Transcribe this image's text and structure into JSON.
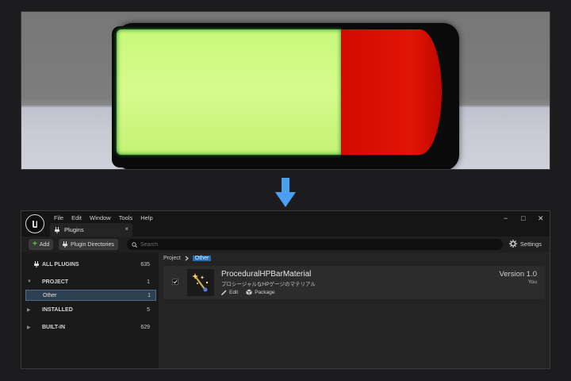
{
  "colors": {
    "accent": "#1f70b8",
    "hp_fill": "#d2fa86",
    "hp_empty": "#e11405",
    "arrow": "#4a9ff0"
  },
  "hp_bar": {
    "fill_fraction": 0.69
  },
  "window": {
    "menu": [
      "File",
      "Edit",
      "Window",
      "Tools",
      "Help"
    ],
    "tab_label": "Plugins",
    "tab_icon": "plug-icon",
    "controls": {
      "minimize": "−",
      "maximize": "□",
      "close": "✕"
    }
  },
  "toolbar": {
    "add_label": "Add",
    "plugin_dirs_label": "Plugin Directories",
    "search_placeholder": "Search",
    "settings_label": "Settings"
  },
  "sidebar": {
    "items": [
      {
        "label": "ALL PLUGINS",
        "count": "635"
      },
      {
        "label": "PROJECT",
        "count": "1"
      },
      {
        "label": "Other",
        "count": "1"
      },
      {
        "label": "INSTALLED",
        "count": "5"
      },
      {
        "label": "BUILT-IN",
        "count": "629"
      }
    ]
  },
  "main": {
    "breadcrumb": [
      "Project",
      "Other"
    ],
    "plugin": {
      "name": "ProceduralHPBarMaterial",
      "description": "プロシージャルなHPゲージのマテリアル",
      "edit_label": "Edit",
      "package_label": "Package",
      "version": "Version 1.0",
      "author": "You",
      "enabled": true
    }
  }
}
